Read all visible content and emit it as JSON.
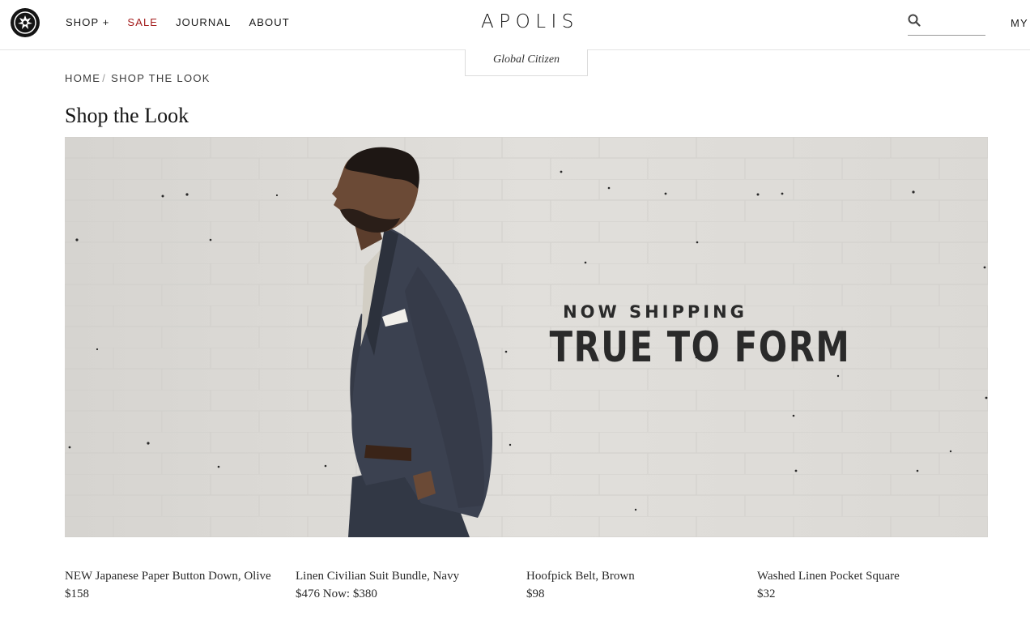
{
  "header": {
    "brand": "APOLIS",
    "tagline": "Global Citizen",
    "nav": [
      {
        "label": "SHOP +"
      },
      {
        "label": "SALE"
      },
      {
        "label": "JOURNAL"
      },
      {
        "label": "ABOUT"
      }
    ],
    "search_placeholder": "",
    "account_label": "MY"
  },
  "breadcrumb": {
    "home": "HOME",
    "separator": "/",
    "current": "SHOP THE LOOK"
  },
  "page": {
    "title": "Shop the Look"
  },
  "hero": {
    "eyebrow": "NOW SHIPPING",
    "headline": "TRUE TO FORM"
  },
  "products": [
    {
      "name": "NEW Japanese Paper Button Down, Olive",
      "price": "$158"
    },
    {
      "name": "Linen Civilian Suit Bundle, Navy",
      "price": "$476 Now: $380"
    },
    {
      "name": "Hoofpick Belt, Brown",
      "price": "$98"
    },
    {
      "name": "Washed Linen Pocket Square",
      "price": "$32"
    }
  ],
  "colors": {
    "sale": "#a31c1c",
    "text": "#1b1b1b",
    "suit": "#3b4150",
    "wall": "#dcdad6"
  }
}
